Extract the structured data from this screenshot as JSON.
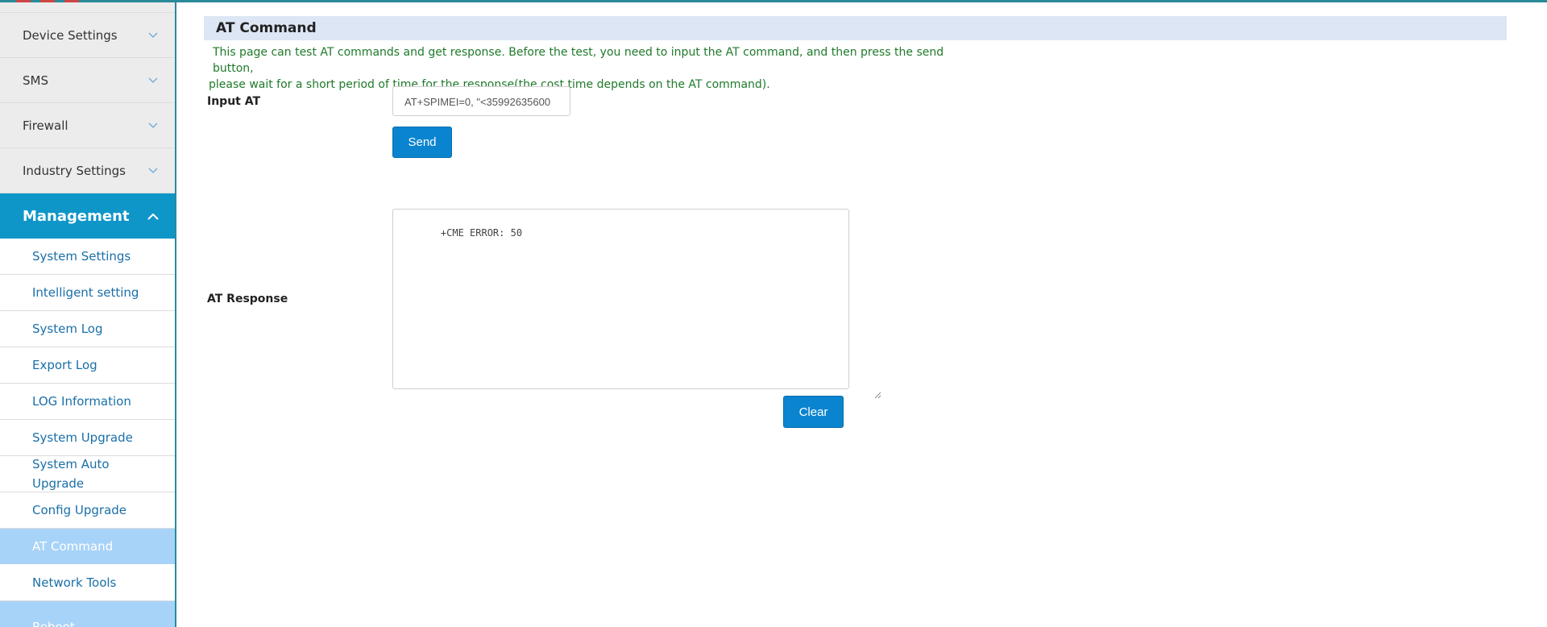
{
  "sidebar": {
    "groups": [
      {
        "label": "Device Settings"
      },
      {
        "label": "SMS"
      },
      {
        "label": "Firewall"
      },
      {
        "label": "Industry Settings"
      }
    ],
    "active_group": {
      "label": "Management"
    },
    "sub_items": [
      {
        "label": "System Settings"
      },
      {
        "label": "Intelligent setting"
      },
      {
        "label": "System Log"
      },
      {
        "label": "Export Log"
      },
      {
        "label": "LOG Information"
      },
      {
        "label": "System Upgrade"
      },
      {
        "label": "System Auto Upgrade"
      },
      {
        "label": "Config Upgrade"
      },
      {
        "label": "AT Command"
      },
      {
        "label": "Network Tools"
      },
      {
        "label": "Reboot"
      }
    ],
    "selected_item": "AT Command"
  },
  "main": {
    "title": "AT Command",
    "description_line1": "This page can test AT commands and get response. Before the test, you need to input the AT command, and then press the send button,",
    "description_line2": "please wait for a short period of time for the response(the cost time depends on the AT command).",
    "input_label": "Input AT",
    "input_value": "AT+SPIMEI=0, \"<35992635600",
    "send_label": "Send",
    "response_label": "AT Response",
    "response_value": "+CME ERROR: 50",
    "clear_label": "Clear"
  },
  "colors": {
    "accent": "#0f96c9",
    "button": "#0b84cf",
    "selected_item_bg": "#a8d3f8",
    "header_bg": "#dce6f4",
    "description_text": "#1f7a2a",
    "link_text": "#1a6fa8",
    "frame_line": "#2b8a9a"
  }
}
